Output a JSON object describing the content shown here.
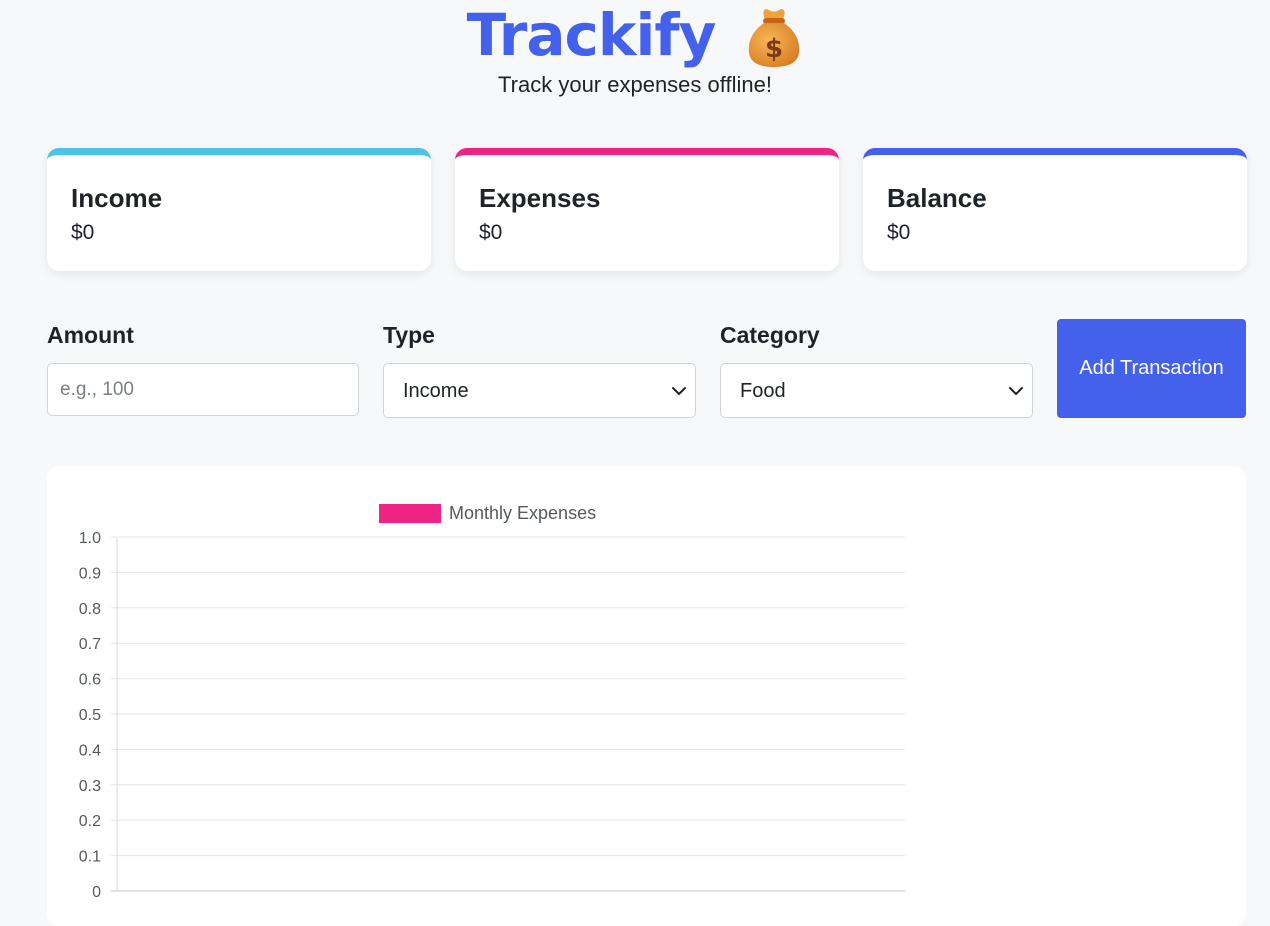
{
  "header": {
    "title": "Trackify",
    "icon": "money-bag-icon",
    "subtitle": "Track your expenses offline!"
  },
  "summary": {
    "income": {
      "label": "Income",
      "value": "$0",
      "color": "#4dc3e5"
    },
    "expenses": {
      "label": "Expenses",
      "value": "$0",
      "color": "#ef2384"
    },
    "balance": {
      "label": "Balance",
      "value": "$0",
      "color": "#4461eb"
    }
  },
  "form": {
    "amount": {
      "label": "Amount",
      "placeholder": "e.g., 100",
      "value": ""
    },
    "type": {
      "label": "Type",
      "selected": "Income"
    },
    "category": {
      "label": "Category",
      "selected": "Food"
    },
    "submit_label": "Add Transaction"
  },
  "colors": {
    "accent": "#4461eb",
    "expense": "#ef2384",
    "income": "#4dc3e5"
  },
  "chart_data": {
    "type": "bar",
    "categories": [],
    "series": [
      {
        "name": "Monthly Expenses",
        "values": [],
        "color": "#ef2384"
      }
    ],
    "ylim": [
      0,
      1.0
    ],
    "yticks": [
      "1.0",
      "0.9",
      "0.8",
      "0.7",
      "0.6",
      "0.5",
      "0.4",
      "0.3",
      "0.2",
      "0.1",
      "0"
    ],
    "grid": true,
    "legend_position": "top"
  }
}
